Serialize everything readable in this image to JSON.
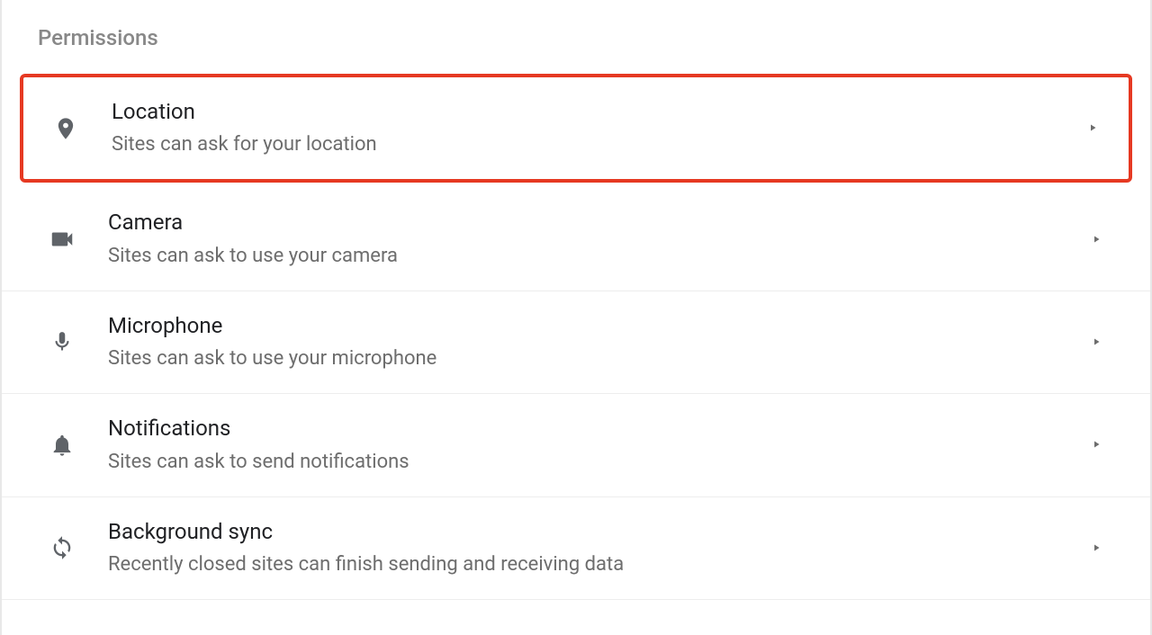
{
  "section_title": "Permissions",
  "items": [
    {
      "icon": "location-pin-icon",
      "title": "Location",
      "subtitle": "Sites can ask for your location",
      "highlighted": true
    },
    {
      "icon": "camera-icon",
      "title": "Camera",
      "subtitle": "Sites can ask to use your camera",
      "highlighted": false
    },
    {
      "icon": "microphone-icon",
      "title": "Microphone",
      "subtitle": "Sites can ask to use your microphone",
      "highlighted": false
    },
    {
      "icon": "bell-icon",
      "title": "Notifications",
      "subtitle": "Sites can ask to send notifications",
      "highlighted": false
    },
    {
      "icon": "sync-icon",
      "title": "Background sync",
      "subtitle": "Recently closed sites can finish sending and receiving data",
      "highlighted": false
    }
  ]
}
